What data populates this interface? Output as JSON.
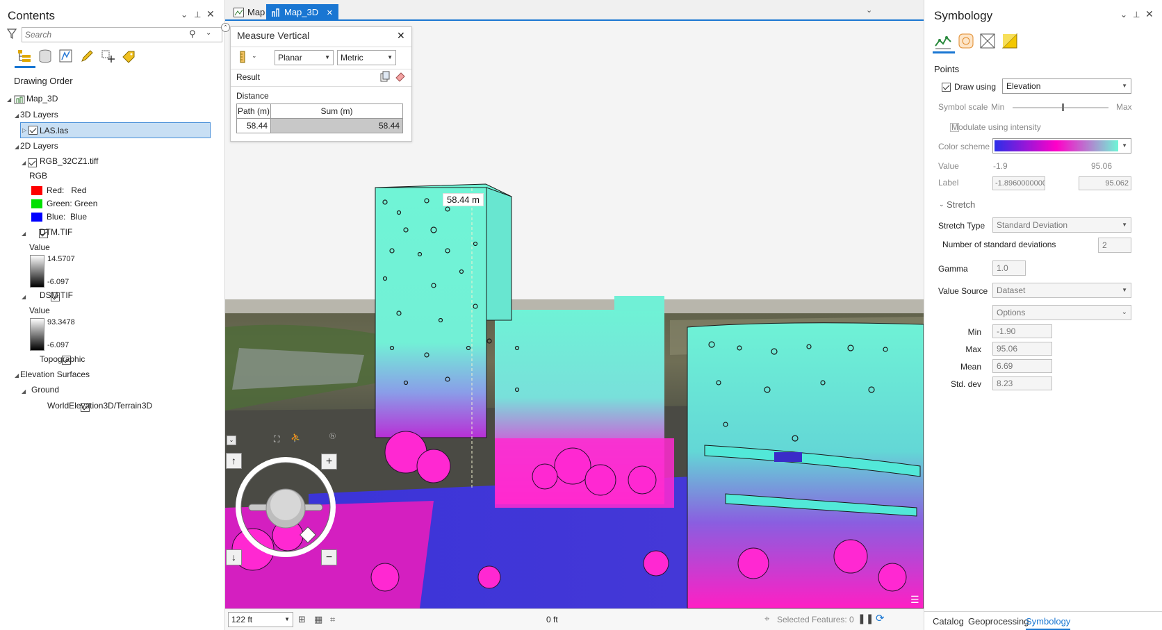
{
  "contents": {
    "title": "Contents",
    "search_placeholder": "Search",
    "drawing_order_label": "Drawing Order",
    "map_name": "Map_3D",
    "layers_3d_label": "3D Layers",
    "las_layer": "LAS.las",
    "layers_2d_label": "2D Layers",
    "rgb_layer": "RGB_32CZ1.tiff",
    "rgb_label": "RGB",
    "rgb_bands": [
      {
        "text": "Red:   Red",
        "color": "#ff0000"
      },
      {
        "text": "Green: Green",
        "color": "#00e000"
      },
      {
        "text": "Blue:  Blue",
        "color": "#0000ff"
      }
    ],
    "dtm_layer": "DTM.TIF",
    "dtm_value_label": "Value",
    "dtm_max": "14.5707",
    "dtm_min": "-6.097",
    "dsm_layer": "DSM.TIF",
    "dsm_value_label": "Value",
    "dsm_max": "93.3478",
    "dsm_min": "-6.097",
    "topographic_layer": "Topographic",
    "elevation_surfaces_label": "Elevation Surfaces",
    "ground_label": "Ground",
    "terrain_layer": "WorldElevation3D/Terrain3D"
  },
  "tabs": [
    {
      "label": "Map",
      "active": false
    },
    {
      "label": "Map_3D",
      "active": true
    }
  ],
  "measure": {
    "title": "Measure Vertical",
    "mode": "Planar",
    "units": "Metric",
    "result_label": "Result",
    "distance_label": "Distance",
    "col_path": "Path (m)",
    "col_sum": "Sum (m)",
    "path_value": "58.44",
    "sum_value": "58.44",
    "map_label": "58.44 m"
  },
  "statusbar": {
    "scale": "122 ft",
    "coord": "0 ft",
    "selected_features": "Selected Features: 0"
  },
  "symbology": {
    "title": "Symbology",
    "section_points": "Points",
    "draw_using_label": "Draw using",
    "draw_using_value": "Elevation",
    "symbol_scale_label": "Symbol scale",
    "scale_min": "Min",
    "scale_max": "Max",
    "modulate_label": "Modulate using intensity",
    "color_scheme_label": "Color scheme",
    "color_scheme_colors": [
      "#2b2ee8",
      "#ff00c8",
      "#6ff5d6"
    ],
    "value_label": "Value",
    "value_min": "-1.9",
    "value_max": "95.06",
    "label_label": "Label",
    "label_min": "-1.8960000000",
    "label_max": "95.062",
    "stretch_label": "Stretch",
    "stretch_type_label": "Stretch Type",
    "stretch_type_value": "Standard Deviation",
    "num_std_label": "Number of standard deviations",
    "num_std_value": "2",
    "gamma_label": "Gamma",
    "gamma_value": "1.0",
    "value_source_label": "Value Source",
    "value_source_value": "Dataset",
    "options_value": "Options",
    "stats": [
      {
        "label": "Min",
        "value": "-1.90"
      },
      {
        "label": "Max",
        "value": "95.06"
      },
      {
        "label": "Mean",
        "value": "6.69"
      },
      {
        "label": "Std. dev",
        "value": "8.23"
      }
    ]
  },
  "bottom_tabs": [
    "Catalog",
    "Geoprocessing",
    "Symbology"
  ]
}
